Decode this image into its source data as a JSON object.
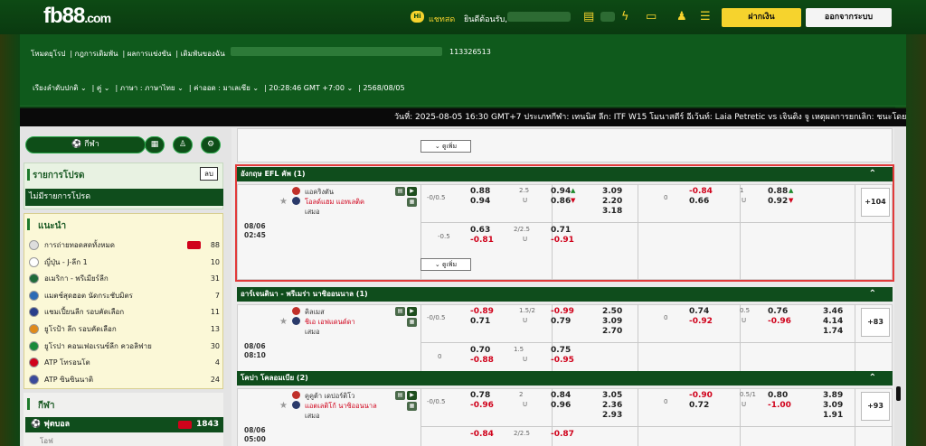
{
  "header": {
    "logo_main": "fb88",
    "logo_suffix": ".com",
    "chat_badge": "Hi",
    "chat_label": "แชทสด",
    "welcome": "ยินดีต้อนรับ,",
    "deposit": "ฝากเงิน",
    "logout": "ออกจากระบบ"
  },
  "nav": {
    "links": [
      "โหมดยุโรป",
      "กฎการเดิมพัน",
      "ผลการแข่งขัน",
      "เดิมพันของฉัน"
    ],
    "account_id": "113326513",
    "settings": [
      "เรียงลำดับปกติ ⌄",
      "คู่ ⌄",
      "ภาษา : ภาษาไทย ⌄",
      "ค่าออด : มาเลเซีย ⌄",
      "20:28:46 GMT +7:00 ⌄",
      "2568/08/05"
    ]
  },
  "ticker": "วันที่: 2025-08-05 16:30 GMT+7 ประเภทกีฬา: เทนนิส ลีก: ITF W15 โมนาสตีร์ อีเว้นท์: Laia Petretic vs เจินติง จู เหตุผลการยกเลิก: ชนะโดยไม่",
  "sidebar": {
    "sport_btn": "⚽ กีฬา",
    "fav_title": "รายการโปรด",
    "fav_delete": "ลบ",
    "fav_none": "ไม่มีรายการโปรด",
    "rec_title": "แนะนำ",
    "rec_items": [
      {
        "label": "การถ่ายทอดสดทั้งหมด",
        "count": "88",
        "live": true,
        "color": "#dddddd"
      },
      {
        "label": "ญี่ปุ่น - J-ลีก 1",
        "count": "10",
        "live": false,
        "color": "#ffffff"
      },
      {
        "label": "อเมริกา - พรีเมียร์ลีก",
        "count": "31",
        "live": false,
        "color": "#1f6b3a"
      },
      {
        "label": "แมตช์สุดฮอต นัดกระชับมิตร",
        "count": "7",
        "live": false,
        "color": "#2c6bb5"
      },
      {
        "label": "แชมเปี้ยนลีก รอบคัดเลือก",
        "count": "11",
        "live": false,
        "color": "#2a3f8a"
      },
      {
        "label": "ยูโรป้า ลีก รอบคัดเลือก",
        "count": "13",
        "live": false,
        "color": "#e08a1a"
      },
      {
        "label": "ยูโรปา คอนเฟอเรนซ์ลีก ควอลิฟาย",
        "count": "30",
        "live": false,
        "color": "#1a8a3a"
      },
      {
        "label": "ATP โทรอนโต",
        "count": "4",
        "live": false,
        "color": "#d0021b"
      },
      {
        "label": "ATP ซินซินนาติ",
        "count": "24",
        "live": false,
        "color": "#3a4a9a"
      }
    ],
    "sports_title": "กีฬา",
    "football": "ฟุตบอล",
    "football_count": "1843",
    "sub": "โอฟ"
  },
  "content": {
    "more": "⌄  ดูเพิ่ม",
    "leagues": [
      {
        "name": "อังกฤษ EFL คัพ (1)",
        "date": "08/06",
        "time": "02:45",
        "home": "แอคริงตัน",
        "away": "โอลด์แฮม แอทเลติค",
        "draw": "เสมอ",
        "r1": {
          "hc": "-0/0.5",
          "h": "0.88",
          "a": "0.94",
          "ou": "2.5",
          "u": "U",
          "o": "0.94",
          "ou_a": "0.86",
          "x1": "3.09",
          "x2": "2.20",
          "x3": "3.18",
          "hc2": "0",
          "h2": "-0.84",
          "a2": "0.66",
          "ou2": "1",
          "u2": "U",
          "o2": "0.88",
          "ou2_a": "0.92"
        },
        "r2": {
          "hc": "-0.5",
          "h": "0.63",
          "a": "-0.81",
          "ou": "2/2.5",
          "u": "U",
          "o": "0.71",
          "ou_a": "-0.91"
        },
        "extra": "+104"
      },
      {
        "name": "อาร์เจนตินา - พรีเมร่า นาซิออนนาล (1)",
        "date": "08/06",
        "time": "08:10",
        "home": "คิลเมส",
        "away": "ชิเอ เอฟแดนด์ดา",
        "draw": "เสมอ",
        "r1": {
          "hc": "-0/0.5",
          "h": "-0.89",
          "a": "0.71",
          "ou": "1.5/2",
          "u": "U",
          "o": "-0.99",
          "ou_a": "0.79",
          "x1": "2.50",
          "x2": "3.09",
          "x3": "2.70",
          "hc2": "0",
          "h2": "0.74",
          "a2": "-0.92",
          "ou2": "0.5",
          "u2": "U",
          "o2": "0.76",
          "ou2_a": "-0.96",
          "y1": "3.46",
          "y2": "4.14",
          "y3": "1.74"
        },
        "r2": {
          "hc": "0",
          "h": "0.70",
          "a": "-0.88",
          "ou": "1.5",
          "u": "U",
          "o": "0.75",
          "ou_a": "-0.95"
        },
        "extra": "+83"
      },
      {
        "name": "โคปา โคลอมเบีย (2)",
        "date": "08/06",
        "time": "05:00",
        "home": "คูคูต้า เดปอร์ติโว",
        "away": "แอตเลติโก้ นาซิออนนาล",
        "draw": "เสมอ",
        "r1": {
          "hc": "-0/0.5",
          "h": "0.78",
          "a": "-0.96",
          "ou": "2",
          "u": "U",
          "o": "0.84",
          "ou_a": "0.96",
          "x1": "3.05",
          "x2": "2.36",
          "x3": "2.93",
          "hc2": "0",
          "h2": "-0.90",
          "a2": "0.72",
          "ou2": "0.5/1",
          "u2": "U",
          "o2": "0.80",
          "ou2_a": "-1.00",
          "y1": "3.89",
          "y2": "3.09",
          "y3": "1.91"
        },
        "r2": {
          "h": "-0.84",
          "ou": "2/2.5",
          "o": "-0.87"
        },
        "extra": "+93"
      }
    ]
  },
  "colors": {
    "brand_green": "#0f4d1c",
    "accent_yellow": "#f6d32d",
    "odds_red": "#d0021b",
    "highlight": "#e23a3a"
  }
}
